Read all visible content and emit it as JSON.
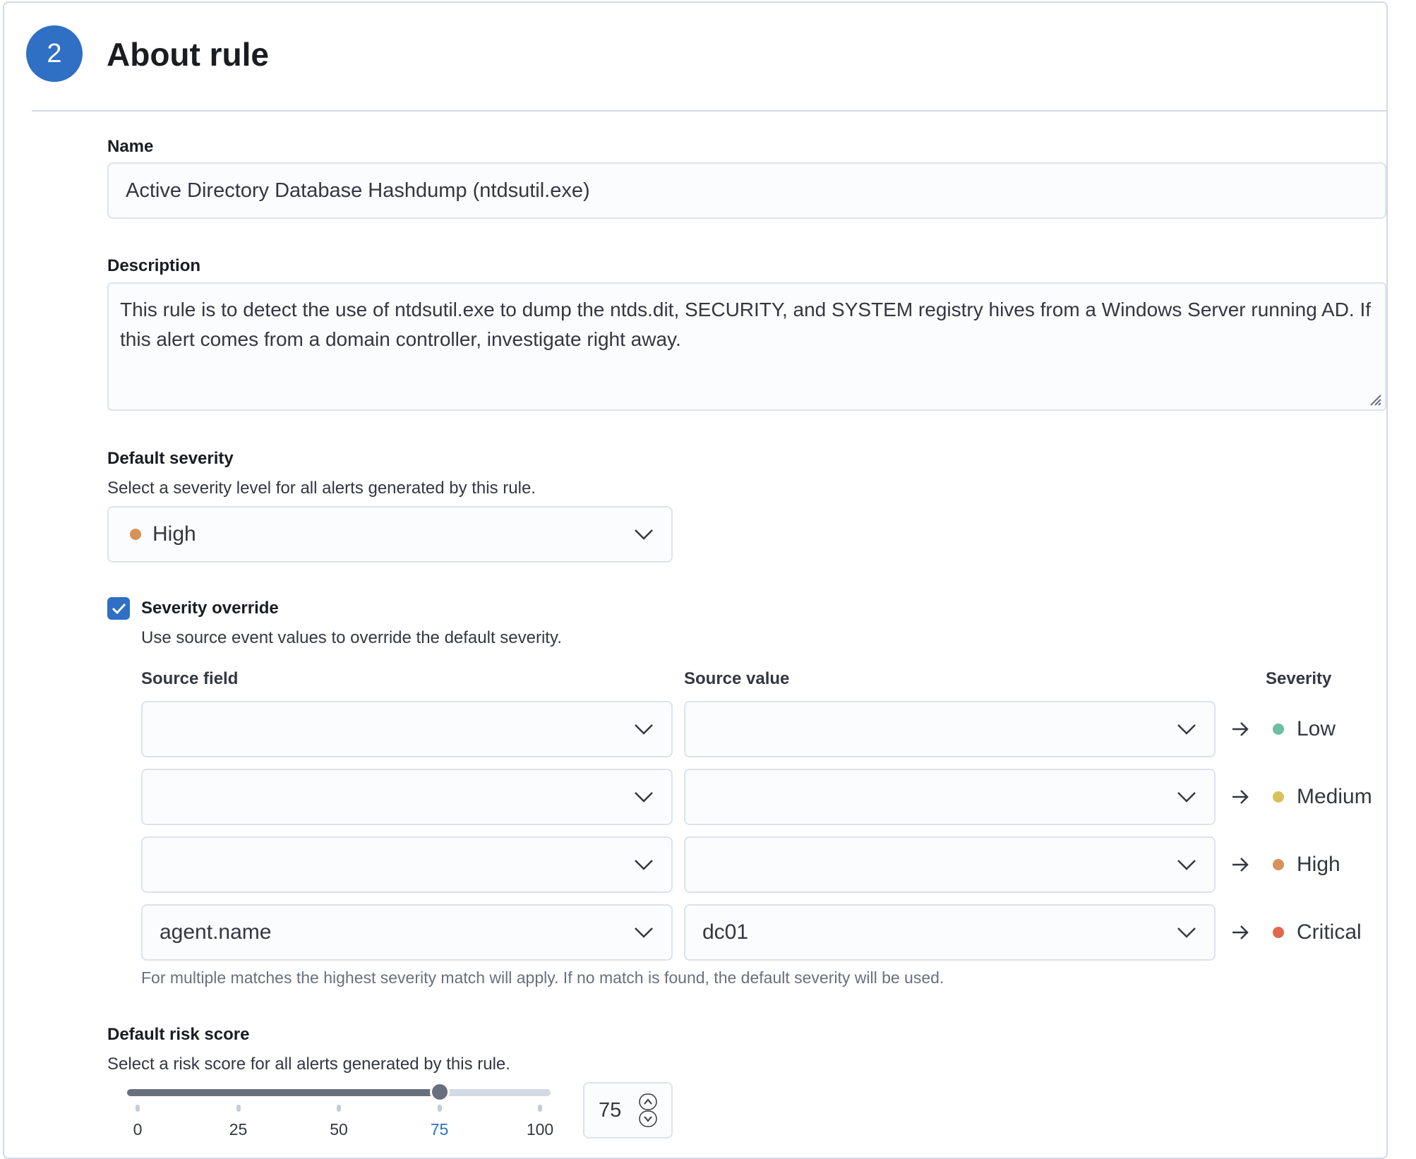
{
  "section": {
    "step_number": "2",
    "title": "About rule"
  },
  "name_field": {
    "label": "Name",
    "value": "Active Directory Database Hashdump (ntdsutil.exe)"
  },
  "description_field": {
    "label": "Description",
    "value": "This rule is to detect the use of ntdsutil.exe to dump the ntds.dit, SECURITY, and SYSTEM registry hives from a Windows Server running AD. If this alert comes from a domain controller, investigate right away."
  },
  "default_severity": {
    "label": "Default severity",
    "help": "Select a severity level for all alerts generated by this rule.",
    "selected": "High",
    "selected_color": "#d6925a"
  },
  "severity_override": {
    "checked": true,
    "label": "Severity override",
    "help": "Use source event values to override the default severity.",
    "columns": {
      "source_field": "Source field",
      "source_value": "Source value",
      "severity": "Severity"
    },
    "rows": [
      {
        "source_field": "",
        "source_value": "",
        "severity": "Low",
        "color": "#6dbfa3"
      },
      {
        "source_field": "",
        "source_value": "",
        "severity": "Medium",
        "color": "#d8c15c"
      },
      {
        "source_field": "",
        "source_value": "",
        "severity": "High",
        "color": "#d6925a"
      },
      {
        "source_field": "agent.name",
        "source_value": "dc01",
        "severity": "Critical",
        "color": "#e2674f"
      }
    ],
    "footnote": "For multiple matches the highest severity match will apply. If no match is found, the default severity will be used."
  },
  "default_risk_score": {
    "label": "Default risk score",
    "help": "Select a risk score for all alerts generated by this rule.",
    "value": "75",
    "value_number": 75,
    "min": 0,
    "max": 100,
    "ticks": [
      "0",
      "25",
      "50",
      "75",
      "100"
    ]
  },
  "colors": {
    "accent": "#2f6fc4",
    "border": "#dde3ec"
  }
}
